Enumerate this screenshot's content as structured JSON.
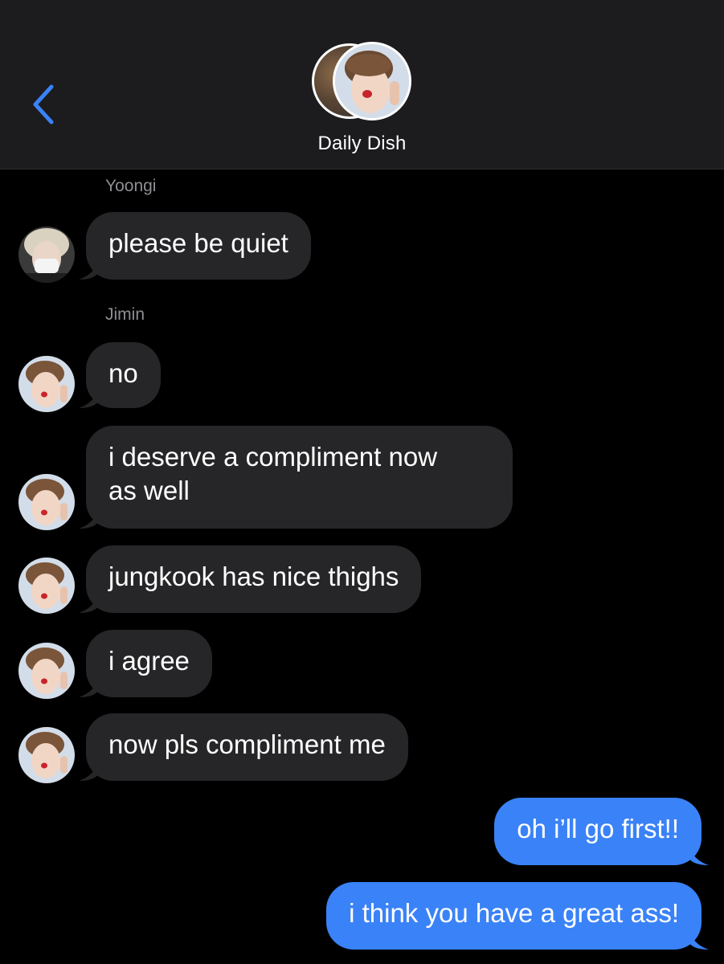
{
  "header": {
    "back_icon": "chevron-left-icon",
    "group_name": "Daily Dish",
    "accent_color": "#3a82f7"
  },
  "messages": [
    {
      "sender": "Yoongi",
      "text": "please be quiet",
      "direction": "incoming"
    },
    {
      "sender": "Jimin",
      "text": "no",
      "direction": "incoming"
    },
    {
      "sender": "Jimin",
      "text_lines": [
        "i deserve a compliment now",
        "as well"
      ],
      "direction": "incoming"
    },
    {
      "sender": "Jimin",
      "text": "jungkook has nice thighs",
      "direction": "incoming"
    },
    {
      "sender": "Jimin",
      "text": "i agree",
      "direction": "incoming"
    },
    {
      "sender": "Jimin",
      "text": "now pls compliment me",
      "direction": "incoming"
    },
    {
      "sender": "me",
      "text": "oh i’ll go first!!",
      "direction": "outgoing"
    },
    {
      "sender": "me",
      "text": "i think you have a great ass!",
      "direction": "outgoing"
    }
  ],
  "colors": {
    "incoming_bubble": "#262628",
    "outgoing_bubble": "#3a82f7",
    "background": "#000000",
    "header_background": "#1c1c1e"
  }
}
